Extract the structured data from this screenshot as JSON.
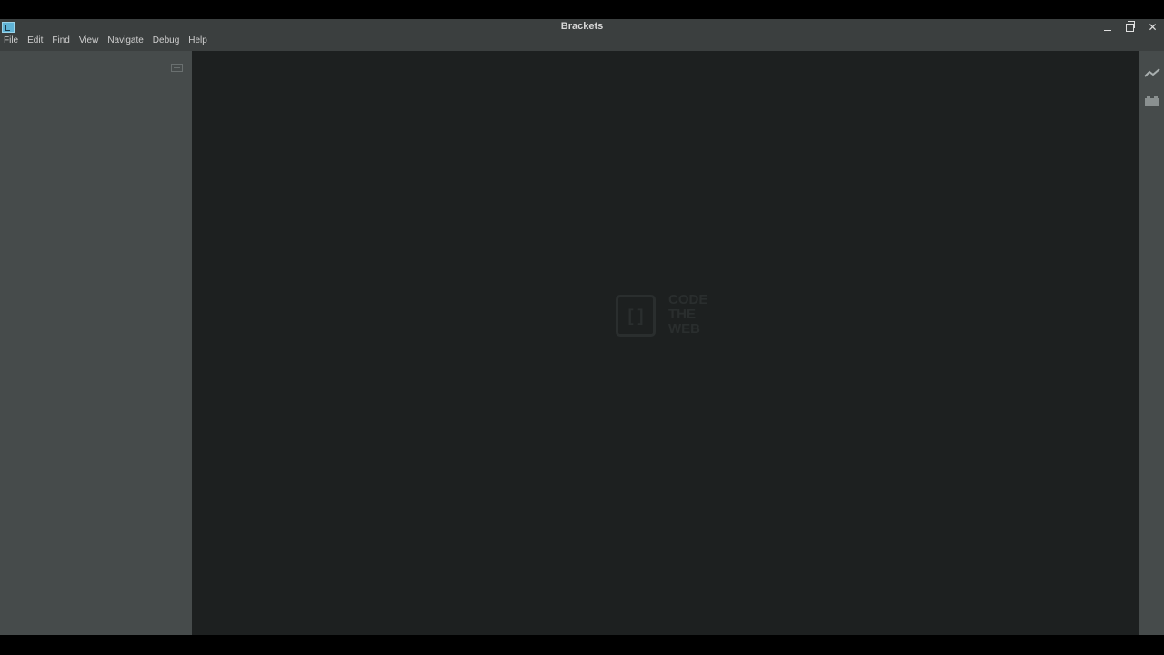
{
  "window": {
    "title": "Brackets",
    "controls": {
      "minimize_icon": "minimize-icon",
      "maximize_icon": "maximize-icon",
      "close_glyph": "✕"
    }
  },
  "menu": {
    "items": [
      "File",
      "Edit",
      "Find",
      "View",
      "Navigate",
      "Debug",
      "Help"
    ]
  },
  "editor": {
    "watermark": {
      "logo_glyph": "[ ]",
      "lines": [
        "CODE",
        "THE",
        "WEB"
      ]
    }
  },
  "toolbar": {
    "icons": [
      "live-preview-icon",
      "extension-manager-icon"
    ]
  },
  "colors": {
    "titlebar": "#3b3f3f",
    "sidebar": "#464b4b",
    "editor": "#1d2020",
    "accent_icon": "#5fb3d6"
  }
}
